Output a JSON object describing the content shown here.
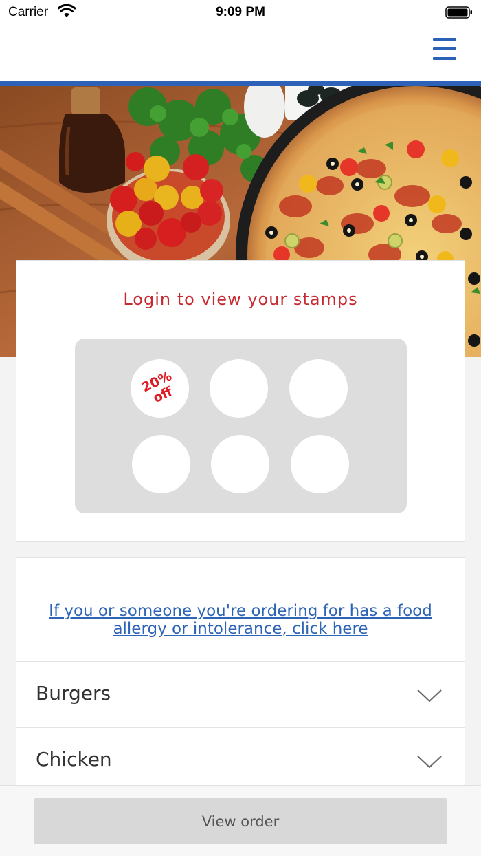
{
  "status_bar": {
    "carrier": "Carrier",
    "time": "9:09 PM"
  },
  "header": {
    "menu_icon": "hamburger-menu-icon",
    "accent_color": "#2e62b8"
  },
  "hero": {
    "image": "pizza-with-tomatoes-and-herbs"
  },
  "stamps": {
    "title": "Login to view your stamps",
    "reward_line1": "20%",
    "reward_line2": "off",
    "total_stamps": 6,
    "title_color": "#c62a30",
    "reward_color": "#e01b23"
  },
  "allergy": {
    "link_text": "If you or someone you're ordering for has a food allergy or intolerance, click here"
  },
  "categories": [
    {
      "label": "Burgers",
      "icon": "chevron-down-icon"
    },
    {
      "label": "Chicken",
      "icon": "chevron-down-icon"
    }
  ],
  "footer": {
    "view_order_label": "View order"
  }
}
